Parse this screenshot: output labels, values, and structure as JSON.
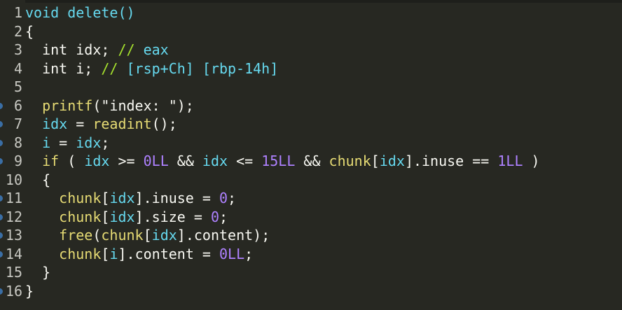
{
  "lines": [
    {
      "num": "1",
      "marker": false,
      "tokens": [
        {
          "t": "void",
          "c": "kw"
        },
        {
          "t": " ",
          "c": "plain"
        },
        {
          "t": "delete",
          "c": "kw"
        },
        {
          "t": "()",
          "c": "kw"
        }
      ]
    },
    {
      "num": "2",
      "marker": false,
      "tokens": [
        {
          "t": "{",
          "c": "plain"
        }
      ]
    },
    {
      "num": "3",
      "marker": false,
      "tokens": [
        {
          "t": "  int idx; ",
          "c": "plain"
        },
        {
          "t": "//",
          "c": "fn"
        },
        {
          "t": " eax",
          "c": "var"
        }
      ]
    },
    {
      "num": "4",
      "marker": false,
      "tokens": [
        {
          "t": "  int i; ",
          "c": "plain"
        },
        {
          "t": "//",
          "c": "fn"
        },
        {
          "t": " [rsp+Ch] [rbp-14h]",
          "c": "var"
        }
      ]
    },
    {
      "num": "5",
      "marker": false,
      "tokens": []
    },
    {
      "num": "6",
      "marker": true,
      "tokens": [
        {
          "t": "  ",
          "c": "plain"
        },
        {
          "t": "printf",
          "c": "fn2"
        },
        {
          "t": "(\"index: \");",
          "c": "plain"
        }
      ]
    },
    {
      "num": "7",
      "marker": true,
      "tokens": [
        {
          "t": "  ",
          "c": "plain"
        },
        {
          "t": "idx",
          "c": "var"
        },
        {
          "t": " = ",
          "c": "plain"
        },
        {
          "t": "readint",
          "c": "fn2"
        },
        {
          "t": "();",
          "c": "plain"
        }
      ]
    },
    {
      "num": "8",
      "marker": true,
      "tokens": [
        {
          "t": "  ",
          "c": "plain"
        },
        {
          "t": "i",
          "c": "var"
        },
        {
          "t": " = ",
          "c": "plain"
        },
        {
          "t": "idx",
          "c": "var"
        },
        {
          "t": ";",
          "c": "plain"
        }
      ]
    },
    {
      "num": "9",
      "marker": true,
      "tokens": [
        {
          "t": "  ",
          "c": "plain"
        },
        {
          "t": "if",
          "c": "fn2"
        },
        {
          "t": " ( ",
          "c": "plain"
        },
        {
          "t": "idx",
          "c": "var"
        },
        {
          "t": " >= ",
          "c": "plain"
        },
        {
          "t": "0LL",
          "c": "num"
        },
        {
          "t": " && ",
          "c": "plain"
        },
        {
          "t": "idx",
          "c": "var"
        },
        {
          "t": " <= ",
          "c": "plain"
        },
        {
          "t": "15LL",
          "c": "num"
        },
        {
          "t": " && ",
          "c": "plain"
        },
        {
          "t": "chunk",
          "c": "fn2"
        },
        {
          "t": "[",
          "c": "plain"
        },
        {
          "t": "idx",
          "c": "var"
        },
        {
          "t": "].inuse == ",
          "c": "plain"
        },
        {
          "t": "1LL",
          "c": "num"
        },
        {
          "t": " )",
          "c": "plain"
        }
      ]
    },
    {
      "num": "10",
      "marker": false,
      "tokens": [
        {
          "t": "  {",
          "c": "plain"
        }
      ]
    },
    {
      "num": "11",
      "marker": true,
      "tokens": [
        {
          "t": "    ",
          "c": "plain"
        },
        {
          "t": "chunk",
          "c": "fn2"
        },
        {
          "t": "[",
          "c": "plain"
        },
        {
          "t": "idx",
          "c": "var"
        },
        {
          "t": "].inuse = ",
          "c": "plain"
        },
        {
          "t": "0",
          "c": "num"
        },
        {
          "t": ";",
          "c": "plain"
        }
      ]
    },
    {
      "num": "12",
      "marker": true,
      "tokens": [
        {
          "t": "    ",
          "c": "plain"
        },
        {
          "t": "chunk",
          "c": "fn2"
        },
        {
          "t": "[",
          "c": "plain"
        },
        {
          "t": "idx",
          "c": "var"
        },
        {
          "t": "].size = ",
          "c": "plain"
        },
        {
          "t": "0",
          "c": "num"
        },
        {
          "t": ";",
          "c": "plain"
        }
      ]
    },
    {
      "num": "13",
      "marker": true,
      "tokens": [
        {
          "t": "    ",
          "c": "plain"
        },
        {
          "t": "free",
          "c": "fn2"
        },
        {
          "t": "(",
          "c": "plain"
        },
        {
          "t": "chunk",
          "c": "fn2"
        },
        {
          "t": "[",
          "c": "plain"
        },
        {
          "t": "idx",
          "c": "var"
        },
        {
          "t": "].content);",
          "c": "plain"
        }
      ]
    },
    {
      "num": "14",
      "marker": true,
      "tokens": [
        {
          "t": "    ",
          "c": "plain"
        },
        {
          "t": "chunk",
          "c": "fn2"
        },
        {
          "t": "[",
          "c": "plain"
        },
        {
          "t": "i",
          "c": "var"
        },
        {
          "t": "].content = ",
          "c": "plain"
        },
        {
          "t": "0LL",
          "c": "num"
        },
        {
          "t": ";",
          "c": "plain"
        }
      ]
    },
    {
      "num": "15",
      "marker": false,
      "tokens": [
        {
          "t": "  }",
          "c": "plain"
        }
      ]
    },
    {
      "num": "16",
      "marker": true,
      "tokens": [
        {
          "t": "}",
          "c": "plain"
        }
      ]
    }
  ]
}
